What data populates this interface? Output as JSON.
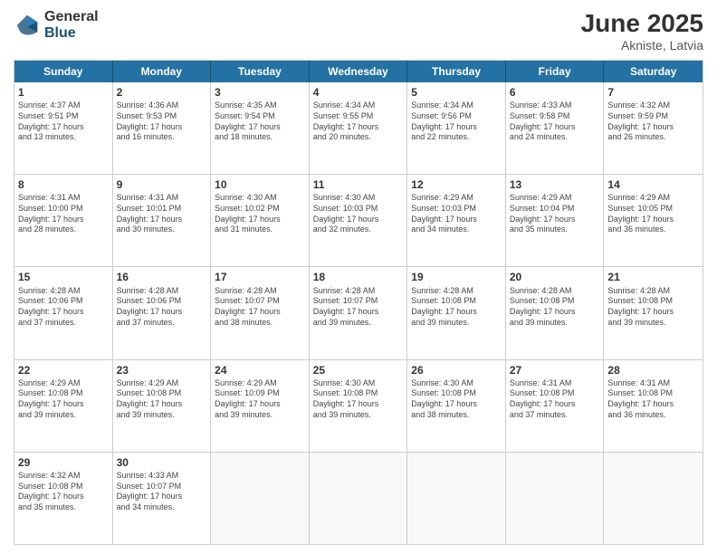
{
  "header": {
    "logo_general": "General",
    "logo_blue": "Blue",
    "month_title": "June 2025",
    "subtitle": "Akniste, Latvia"
  },
  "weekdays": [
    "Sunday",
    "Monday",
    "Tuesday",
    "Wednesday",
    "Thursday",
    "Friday",
    "Saturday"
  ],
  "weeks": [
    [
      {
        "day": "1",
        "info": "Sunrise: 4:37 AM\nSunset: 9:51 PM\nDaylight: 17 hours\nand 13 minutes."
      },
      {
        "day": "2",
        "info": "Sunrise: 4:36 AM\nSunset: 9:53 PM\nDaylight: 17 hours\nand 16 minutes."
      },
      {
        "day": "3",
        "info": "Sunrise: 4:35 AM\nSunset: 9:54 PM\nDaylight: 17 hours\nand 18 minutes."
      },
      {
        "day": "4",
        "info": "Sunrise: 4:34 AM\nSunset: 9:55 PM\nDaylight: 17 hours\nand 20 minutes."
      },
      {
        "day": "5",
        "info": "Sunrise: 4:34 AM\nSunset: 9:56 PM\nDaylight: 17 hours\nand 22 minutes."
      },
      {
        "day": "6",
        "info": "Sunrise: 4:33 AM\nSunset: 9:58 PM\nDaylight: 17 hours\nand 24 minutes."
      },
      {
        "day": "7",
        "info": "Sunrise: 4:32 AM\nSunset: 9:59 PM\nDaylight: 17 hours\nand 26 minutes."
      }
    ],
    [
      {
        "day": "8",
        "info": "Sunrise: 4:31 AM\nSunset: 10:00 PM\nDaylight: 17 hours\nand 28 minutes."
      },
      {
        "day": "9",
        "info": "Sunrise: 4:31 AM\nSunset: 10:01 PM\nDaylight: 17 hours\nand 30 minutes."
      },
      {
        "day": "10",
        "info": "Sunrise: 4:30 AM\nSunset: 10:02 PM\nDaylight: 17 hours\nand 31 minutes."
      },
      {
        "day": "11",
        "info": "Sunrise: 4:30 AM\nSunset: 10:03 PM\nDaylight: 17 hours\nand 32 minutes."
      },
      {
        "day": "12",
        "info": "Sunrise: 4:29 AM\nSunset: 10:03 PM\nDaylight: 17 hours\nand 34 minutes."
      },
      {
        "day": "13",
        "info": "Sunrise: 4:29 AM\nSunset: 10:04 PM\nDaylight: 17 hours\nand 35 minutes."
      },
      {
        "day": "14",
        "info": "Sunrise: 4:29 AM\nSunset: 10:05 PM\nDaylight: 17 hours\nand 36 minutes."
      }
    ],
    [
      {
        "day": "15",
        "info": "Sunrise: 4:28 AM\nSunset: 10:06 PM\nDaylight: 17 hours\nand 37 minutes."
      },
      {
        "day": "16",
        "info": "Sunrise: 4:28 AM\nSunset: 10:06 PM\nDaylight: 17 hours\nand 37 minutes."
      },
      {
        "day": "17",
        "info": "Sunrise: 4:28 AM\nSunset: 10:07 PM\nDaylight: 17 hours\nand 38 minutes."
      },
      {
        "day": "18",
        "info": "Sunrise: 4:28 AM\nSunset: 10:07 PM\nDaylight: 17 hours\nand 39 minutes."
      },
      {
        "day": "19",
        "info": "Sunrise: 4:28 AM\nSunset: 10:08 PM\nDaylight: 17 hours\nand 39 minutes."
      },
      {
        "day": "20",
        "info": "Sunrise: 4:28 AM\nSunset: 10:08 PM\nDaylight: 17 hours\nand 39 minutes."
      },
      {
        "day": "21",
        "info": "Sunrise: 4:28 AM\nSunset: 10:08 PM\nDaylight: 17 hours\nand 39 minutes."
      }
    ],
    [
      {
        "day": "22",
        "info": "Sunrise: 4:29 AM\nSunset: 10:08 PM\nDaylight: 17 hours\nand 39 minutes."
      },
      {
        "day": "23",
        "info": "Sunrise: 4:29 AM\nSunset: 10:08 PM\nDaylight: 17 hours\nand 39 minutes."
      },
      {
        "day": "24",
        "info": "Sunrise: 4:29 AM\nSunset: 10:09 PM\nDaylight: 17 hours\nand 39 minutes."
      },
      {
        "day": "25",
        "info": "Sunrise: 4:30 AM\nSunset: 10:08 PM\nDaylight: 17 hours\nand 39 minutes."
      },
      {
        "day": "26",
        "info": "Sunrise: 4:30 AM\nSunset: 10:08 PM\nDaylight: 17 hours\nand 38 minutes."
      },
      {
        "day": "27",
        "info": "Sunrise: 4:31 AM\nSunset: 10:08 PM\nDaylight: 17 hours\nand 37 minutes."
      },
      {
        "day": "28",
        "info": "Sunrise: 4:31 AM\nSunset: 10:08 PM\nDaylight: 17 hours\nand 36 minutes."
      }
    ],
    [
      {
        "day": "29",
        "info": "Sunrise: 4:32 AM\nSunset: 10:08 PM\nDaylight: 17 hours\nand 35 minutes."
      },
      {
        "day": "30",
        "info": "Sunrise: 4:33 AM\nSunset: 10:07 PM\nDaylight: 17 hours\nand 34 minutes."
      },
      {
        "day": "",
        "info": ""
      },
      {
        "day": "",
        "info": ""
      },
      {
        "day": "",
        "info": ""
      },
      {
        "day": "",
        "info": ""
      },
      {
        "day": "",
        "info": ""
      }
    ]
  ]
}
